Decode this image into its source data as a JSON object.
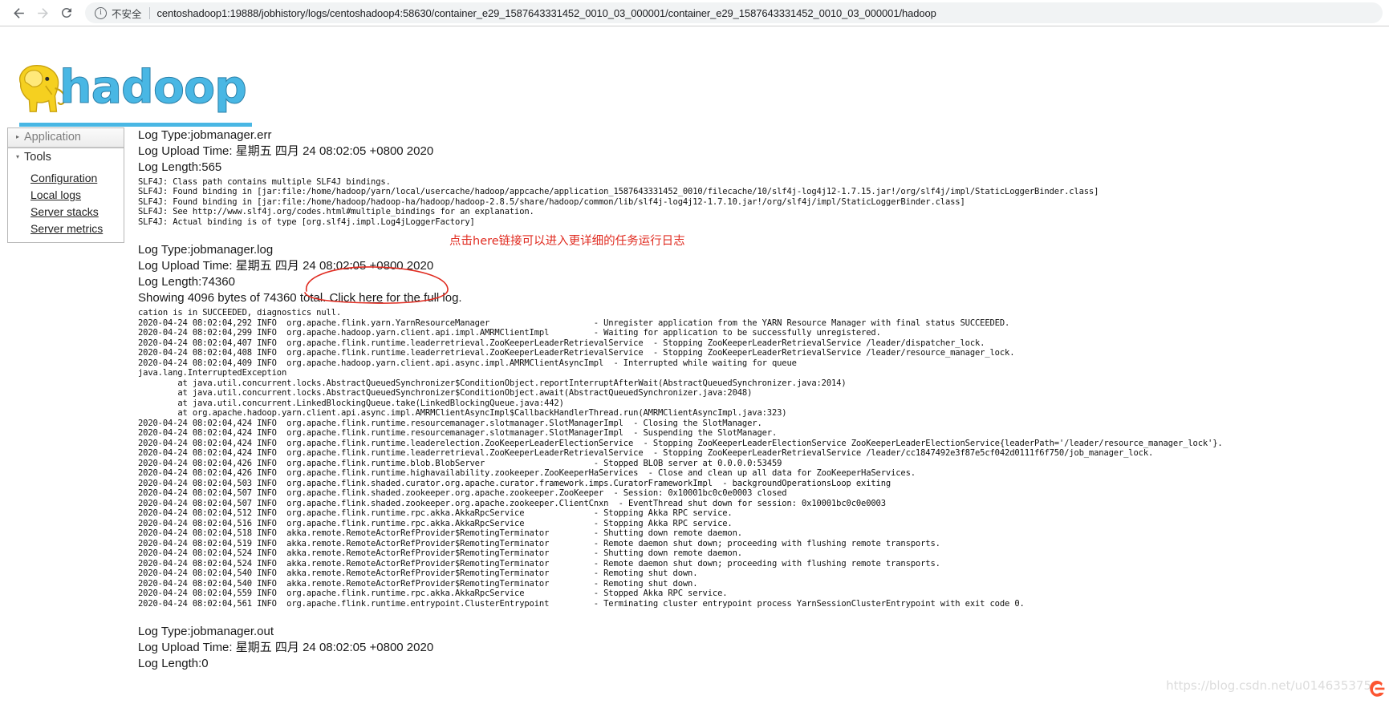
{
  "browser": {
    "back_icon": "back-arrow-icon",
    "forward_icon": "forward-arrow-icon",
    "reload_icon": "reload-icon",
    "info_glyph": "i",
    "security_label": "不安全",
    "url": "centoshadoop1:19888/jobhistory/logs/centoshadoop4:58630/container_e29_1587643331452_0010_03_000001/container_e29_1587643331452_0010_03_000001/hadoop"
  },
  "branding": {
    "logo_text": "hadoop",
    "logo_color": "#49b7e4"
  },
  "sidebar": {
    "application": {
      "label": "Application",
      "triangle": "▸",
      "expanded": false
    },
    "tools": {
      "label": "Tools",
      "triangle": "▾",
      "expanded": true,
      "items": [
        {
          "label": "Configuration"
        },
        {
          "label": "Local logs"
        },
        {
          "label": "Server stacks"
        },
        {
          "label": "Server metrics"
        }
      ]
    }
  },
  "sections": [
    {
      "id": "jobmanager-err",
      "type_label": "Log Type:",
      "type_value": "jobmanager.err",
      "upload_label": "Log Upload Time:",
      "upload_value": "星期五 四月 24 08:02:05 +0800 2020",
      "length_label": "Log Length:",
      "length_value": "565",
      "body": "SLF4J: Class path contains multiple SLF4J bindings.\nSLF4J: Found binding in [jar:file:/home/hadoop/yarn/local/usercache/hadoop/appcache/application_1587643331452_0010/filecache/10/slf4j-log4j12-1.7.15.jar!/org/slf4j/impl/StaticLoggerBinder.class]\nSLF4J: Found binding in [jar:file:/home/hadoop/hadoop-ha/hadoop/hadoop-2.8.5/share/hadoop/common/lib/slf4j-log4j12-1.7.10.jar!/org/slf4j/impl/StaticLoggerBinder.class]\nSLF4J: See http://www.slf4j.org/codes.html#multiple_bindings for an explanation.\nSLF4J: Actual binding is of type [org.slf4j.impl.Log4jLoggerFactory]"
    }
  ],
  "log_section": {
    "type_label": "Log Type:",
    "type_value": "jobmanager.log",
    "upload_label": "Log Upload Time:",
    "upload_value": "星期五 四月 24 08:02:05 +0800 2020",
    "length_label": "Log Length:",
    "length_value": "74360",
    "showing_prefix": "Showing 4096 bytes of 74360 total. Click ",
    "showing_link": "here",
    "showing_suffix": " for the full log.",
    "body": "cation is in SUCCEEDED, diagnostics null.\n2020-04-24 08:02:04,292 INFO  org.apache.flink.yarn.YarnResourceManager                     - Unregister application from the YARN Resource Manager with final status SUCCEEDED.\n2020-04-24 08:02:04,299 INFO  org.apache.hadoop.yarn.client.api.impl.AMRMClientImpl         - Waiting for application to be successfully unregistered.\n2020-04-24 08:02:04,407 INFO  org.apache.flink.runtime.leaderretrieval.ZooKeeperLeaderRetrievalService  - Stopping ZooKeeperLeaderRetrievalService /leader/dispatcher_lock.\n2020-04-24 08:02:04,408 INFO  org.apache.flink.runtime.leaderretrieval.ZooKeeperLeaderRetrievalService  - Stopping ZooKeeperLeaderRetrievalService /leader/resource_manager_lock.\n2020-04-24 08:02:04,409 INFO  org.apache.hadoop.yarn.client.api.async.impl.AMRMClientAsyncImpl  - Interrupted while waiting for queue\njava.lang.InterruptedException\n        at java.util.concurrent.locks.AbstractQueuedSynchronizer$ConditionObject.reportInterruptAfterWait(AbstractQueuedSynchronizer.java:2014)\n        at java.util.concurrent.locks.AbstractQueuedSynchronizer$ConditionObject.await(AbstractQueuedSynchronizer.java:2048)\n        at java.util.concurrent.LinkedBlockingQueue.take(LinkedBlockingQueue.java:442)\n        at org.apache.hadoop.yarn.client.api.async.impl.AMRMClientAsyncImpl$CallbackHandlerThread.run(AMRMClientAsyncImpl.java:323)\n2020-04-24 08:02:04,424 INFO  org.apache.flink.runtime.resourcemanager.slotmanager.SlotManagerImpl  - Closing the SlotManager.\n2020-04-24 08:02:04,424 INFO  org.apache.flink.runtime.resourcemanager.slotmanager.SlotManagerImpl  - Suspending the SlotManager.\n2020-04-24 08:02:04,424 INFO  org.apache.flink.runtime.leaderelection.ZooKeeperLeaderElectionService  - Stopping ZooKeeperLeaderElectionService ZooKeeperLeaderElectionService{leaderPath='/leader/resource_manager_lock'}.\n2020-04-24 08:02:04,424 INFO  org.apache.flink.runtime.leaderretrieval.ZooKeeperLeaderRetrievalService  - Stopping ZooKeeperLeaderRetrievalService /leader/cc1847492e3f87e5cf042d0111f6f750/job_manager_lock.\n2020-04-24 08:02:04,426 INFO  org.apache.flink.runtime.blob.BlobServer                      - Stopped BLOB server at 0.0.0.0:53459\n2020-04-24 08:02:04,426 INFO  org.apache.flink.runtime.highavailability.zookeeper.ZooKeeperHaServices  - Close and clean up all data for ZooKeeperHaServices.\n2020-04-24 08:02:04,503 INFO  org.apache.flink.shaded.curator.org.apache.curator.framework.imps.CuratorFrameworkImpl  - backgroundOperationsLoop exiting\n2020-04-24 08:02:04,507 INFO  org.apache.flink.shaded.zookeeper.org.apache.zookeeper.ZooKeeper  - Session: 0x10001bc0c0e0003 closed\n2020-04-24 08:02:04,507 INFO  org.apache.flink.shaded.zookeeper.org.apache.zookeeper.ClientCnxn  - EventThread shut down for session: 0x10001bc0c0e0003\n2020-04-24 08:02:04,512 INFO  org.apache.flink.runtime.rpc.akka.AkkaRpcService              - Stopping Akka RPC service.\n2020-04-24 08:02:04,516 INFO  org.apache.flink.runtime.rpc.akka.AkkaRpcService              - Stopping Akka RPC service.\n2020-04-24 08:02:04,518 INFO  akka.remote.RemoteActorRefProvider$RemotingTerminator         - Shutting down remote daemon.\n2020-04-24 08:02:04,519 INFO  akka.remote.RemoteActorRefProvider$RemotingTerminator         - Remote daemon shut down; proceeding with flushing remote transports.\n2020-04-24 08:02:04,524 INFO  akka.remote.RemoteActorRefProvider$RemotingTerminator         - Shutting down remote daemon.\n2020-04-24 08:02:04,524 INFO  akka.remote.RemoteActorRefProvider$RemotingTerminator         - Remote daemon shut down; proceeding with flushing remote transports.\n2020-04-24 08:02:04,540 INFO  akka.remote.RemoteActorRefProvider$RemotingTerminator         - Remoting shut down.\n2020-04-24 08:02:04,540 INFO  akka.remote.RemoteActorRefProvider$RemotingTerminator         - Remoting shut down.\n2020-04-24 08:02:04,559 INFO  org.apache.flink.runtime.rpc.akka.AkkaRpcService              - Stopped Akka RPC service.\n2020-04-24 08:02:04,561 INFO  org.apache.flink.runtime.entrypoint.ClusterEntrypoint         - Terminating cluster entrypoint process YarnSessionClusterEntrypoint with exit code 0."
  },
  "out_section": {
    "type_label": "Log Type:",
    "type_value": "jobmanager.out",
    "upload_label": "Log Upload Time:",
    "upload_value": "星期五 四月 24 08:02:05 +0800 2020",
    "length_label": "Log Length:",
    "length_value": "0"
  },
  "annotation": {
    "text": "点击here链接可以进入更详细的任务运行日志",
    "color": "#e02b20"
  },
  "watermark": {
    "url": "https://blog.csdn.net/u014635375"
  }
}
